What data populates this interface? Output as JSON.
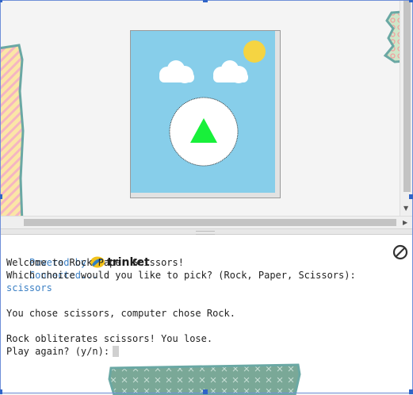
{
  "console": {
    "powered_by": "Powered by",
    "brand": "trinket",
    "status": "Connected...",
    "lines": [
      "Welcome to Rock Paper Scissors!",
      "Which choice would you like to pick? (Rock, Paper, Scissors):",
      "scissors",
      "",
      "You chose scissors, computer chose Rock.",
      "",
      "Rock obliterates scissors! You lose.",
      "Play again? (y/n):"
    ]
  },
  "scene": {
    "sky_color": "#87ceea",
    "sun_color": "#f5d442",
    "cloud_color": "#ffffff",
    "badge_color": "#ffffff",
    "shape_color": "#18f03a",
    "shape": "triangle"
  },
  "icons": {
    "stop": "stop-icon",
    "trinket": "trinket-logo-icon"
  }
}
